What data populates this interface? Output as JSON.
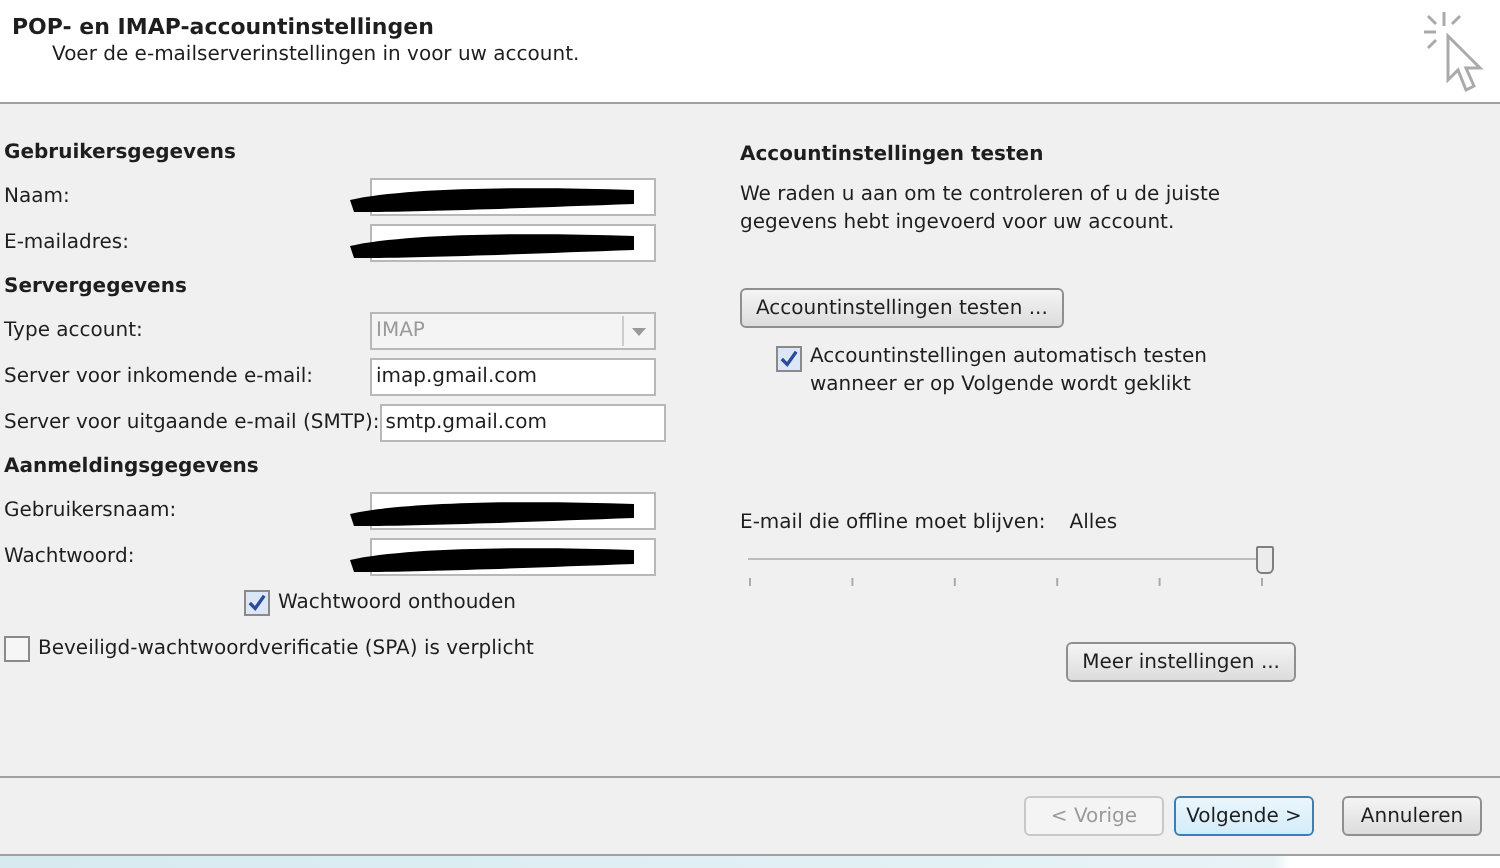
{
  "header": {
    "title": "POP- en IMAP-accountinstellingen",
    "subtitle": "Voer de e-mailserverinstellingen in voor uw account."
  },
  "sections": [
    {
      "heading": "Gebruikersgegevens",
      "fields": [
        {
          "label": "Naam:",
          "kind": "text",
          "redacted": true
        },
        {
          "label": "E-mailadres:",
          "kind": "text",
          "redacted": true
        }
      ]
    },
    {
      "heading": "Servergegevens",
      "fields": [
        {
          "label": "Type account:",
          "kind": "dropdown",
          "value": "IMAP",
          "disabled": true
        },
        {
          "label": "Server voor inkomende e-mail:",
          "kind": "text",
          "value": "imap.gmail.com"
        },
        {
          "label": "Server voor uitgaande e-mail (SMTP):",
          "kind": "text",
          "value": "smtp.gmail.com"
        }
      ]
    },
    {
      "heading": "Aanmeldingsgegevens",
      "fields": [
        {
          "label": "Gebruikersnaam:",
          "kind": "text",
          "redacted": true
        },
        {
          "label": "Wachtwoord:",
          "kind": "text",
          "redacted": true
        }
      ]
    }
  ],
  "remember_password": {
    "label": "Wachtwoord onthouden",
    "checked": true
  },
  "spa": {
    "label": "Beveiligd-wachtwoordverificatie (SPA) is verplicht",
    "checked": false
  },
  "test": {
    "heading": "Accountinstellingen testen",
    "description": "We raden u aan om te controleren of u de juiste gegevens hebt ingevoerd voor uw account.",
    "button": "Accountinstellingen testen ...",
    "auto_test": {
      "label": "Accountinstellingen automatisch testen wanneer er op Volgende wordt geklikt",
      "checked": true
    }
  },
  "offline": {
    "label": "E-mail die offline moet blijven:",
    "value": "Alles",
    "level": 1
  },
  "more_button": "Meer instellingen ...",
  "footer_buttons": [
    {
      "label": "< Vorige",
      "disabled": true,
      "selected": false
    },
    {
      "label": "Volgende >",
      "disabled": false,
      "selected": true
    },
    {
      "label": "Annuleren",
      "disabled": false,
      "selected": false
    }
  ]
}
